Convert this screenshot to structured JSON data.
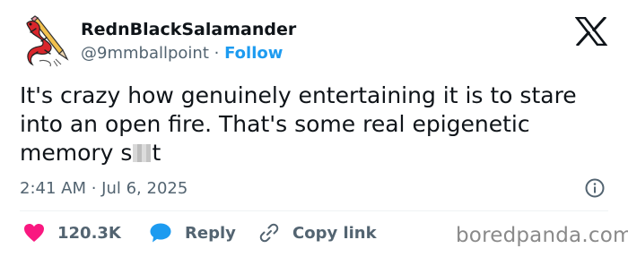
{
  "author": {
    "display_name": "RednBlackSalamander",
    "handle": "@9mmballpoint",
    "separator": "·",
    "follow_label": "Follow"
  },
  "tweet": {
    "lines": [
      "It's crazy how genuinely entertaining it is to stare",
      "into an open fire. That's some real epigenetic",
      "memory s"
    ],
    "line3_tail": "t",
    "timestamp": "2:41 AM · Jul 6, 2025"
  },
  "actions": {
    "like_count": "120.3K",
    "reply_label": "Reply",
    "copy_link_label": "Copy link"
  },
  "watermark": "boredpanda.com",
  "icons": {
    "x_logo": "x-logo-icon",
    "info": "info-icon",
    "like": "heart-icon",
    "reply": "speech-bubble-icon",
    "copy": "link-icon"
  },
  "colors": {
    "text": "#0f1419",
    "secondary": "#536471",
    "accent": "#1d9bf0",
    "like": "#f91880",
    "avatar_red": "#d9262c"
  }
}
